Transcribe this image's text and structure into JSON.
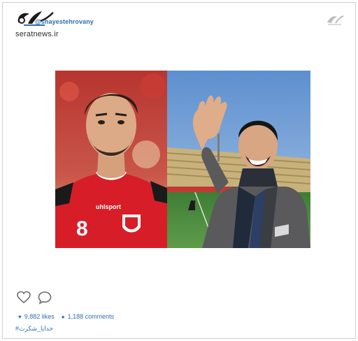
{
  "header": {
    "handle": "@shayestehrovany",
    "site": "seratnews.ir"
  },
  "post": {
    "likes": "9,882 likes",
    "comments": "1,188 comments",
    "hashtag": "#خدایا_شکرت",
    "photo_left_shirt_number": "8",
    "photo_left_brand": "uhlsport"
  },
  "icons": {
    "like": "heart-icon",
    "comment": "comment-bubble-icon",
    "likes_stat": "heart-icon",
    "comments_stat": "speech-dot-icon"
  },
  "colors": {
    "link_blue": "#2f6fae",
    "jersey_red": "#d71e28",
    "sky_blue": "#7ea6d6"
  }
}
